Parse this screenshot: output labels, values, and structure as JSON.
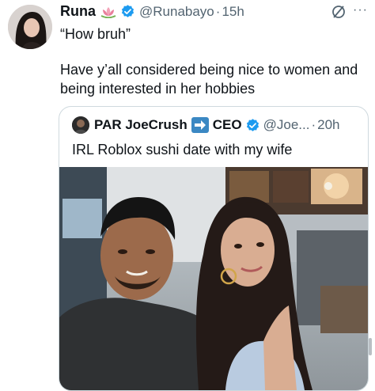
{
  "tweet": {
    "author_name": "Runa",
    "author_handle": "@Runabayo",
    "separator": "·",
    "timestamp": "15h",
    "more_label": "···",
    "reply_line": "“How bruh”",
    "body": "Have y’all considered being nice to women and being interested in her hobbies"
  },
  "quote": {
    "author_name": "PAR JoeCrush",
    "author_name_suffix": "CEO",
    "author_handle": "@Joe...",
    "separator": "·",
    "timestamp": "20h",
    "text": "IRL Roblox sushi date with my wife"
  },
  "colors": {
    "verified": "#1d9bf0",
    "secondary_text": "#536471",
    "border": "#cfd9de"
  },
  "icons": {
    "verified": "verified-badge-icon",
    "flower": "lotus-flower-icon",
    "grok": "grok-icon",
    "arrow": "right-arrow-emoji-icon"
  }
}
